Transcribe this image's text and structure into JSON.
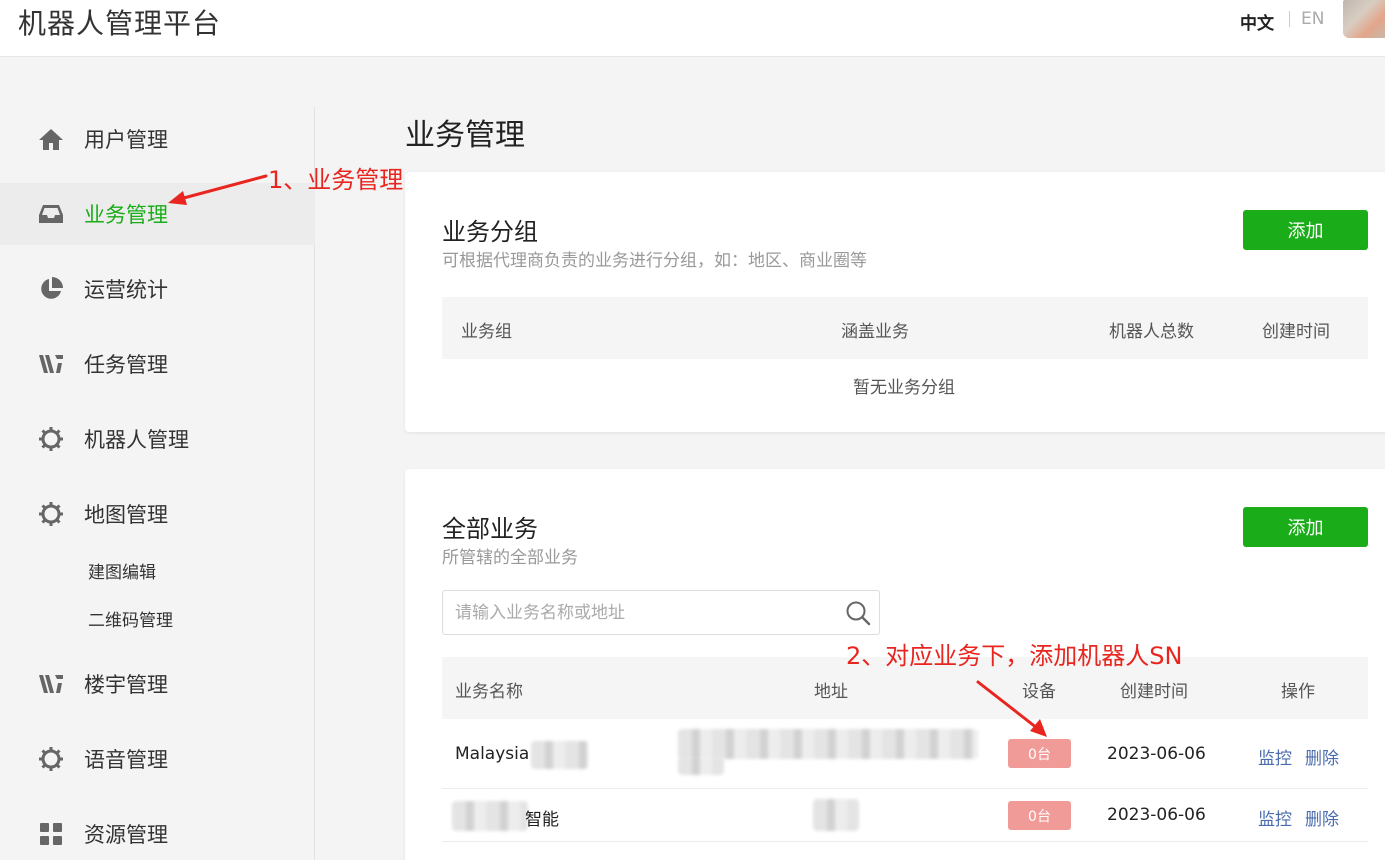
{
  "header": {
    "app_title": "机器人管理平台",
    "lang_zh": "中文",
    "lang_en": "EN"
  },
  "sidebar": {
    "items": [
      {
        "label": "用户管理",
        "icon": "home-icon"
      },
      {
        "label": "业务管理",
        "icon": "inbox-icon",
        "active": true
      },
      {
        "label": "运营统计",
        "icon": "pie-chart-icon"
      },
      {
        "label": "任务管理",
        "icon": "task-icon"
      },
      {
        "label": "机器人管理",
        "icon": "gear-icon"
      },
      {
        "label": "地图管理",
        "icon": "gear-icon"
      },
      {
        "label": "楼宇管理",
        "icon": "task-icon"
      },
      {
        "label": "语音管理",
        "icon": "gear-icon"
      },
      {
        "label": "资源管理",
        "icon": "grid-icon"
      }
    ],
    "sub_items": [
      "建图编辑",
      "二维码管理"
    ]
  },
  "main": {
    "page_title": "业务管理",
    "groups": {
      "title": "业务分组",
      "desc": "可根据代理商负责的业务进行分组，如：地区、商业圈等",
      "add_label": "添加",
      "columns": [
        "业务组",
        "涵盖业务",
        "机器人总数",
        "创建时间"
      ],
      "empty_text": "暂无业务分组"
    },
    "all": {
      "title": "全部业务",
      "desc": "所管辖的全部业务",
      "add_label": "添加",
      "search_placeholder": "请输入业务名称或地址",
      "columns": [
        "业务名称",
        "地址",
        "设备",
        "创建时间",
        "操作"
      ],
      "rows": [
        {
          "name": "Malaysia",
          "devices": "0台",
          "created": "2023-06-06",
          "monitor": "监控",
          "delete": "删除"
        },
        {
          "name": "智能",
          "devices": "0台",
          "created": "2023-06-06",
          "monitor": "监控",
          "delete": "删除"
        }
      ]
    }
  },
  "annotations": {
    "step1": "1、业务管理",
    "step2": "2、对应业务下，添加机器人SN"
  },
  "colors": {
    "accent": "#1aad19",
    "badge": "#f19b98",
    "link": "#4a6cad",
    "annotation": "#e8261f"
  }
}
